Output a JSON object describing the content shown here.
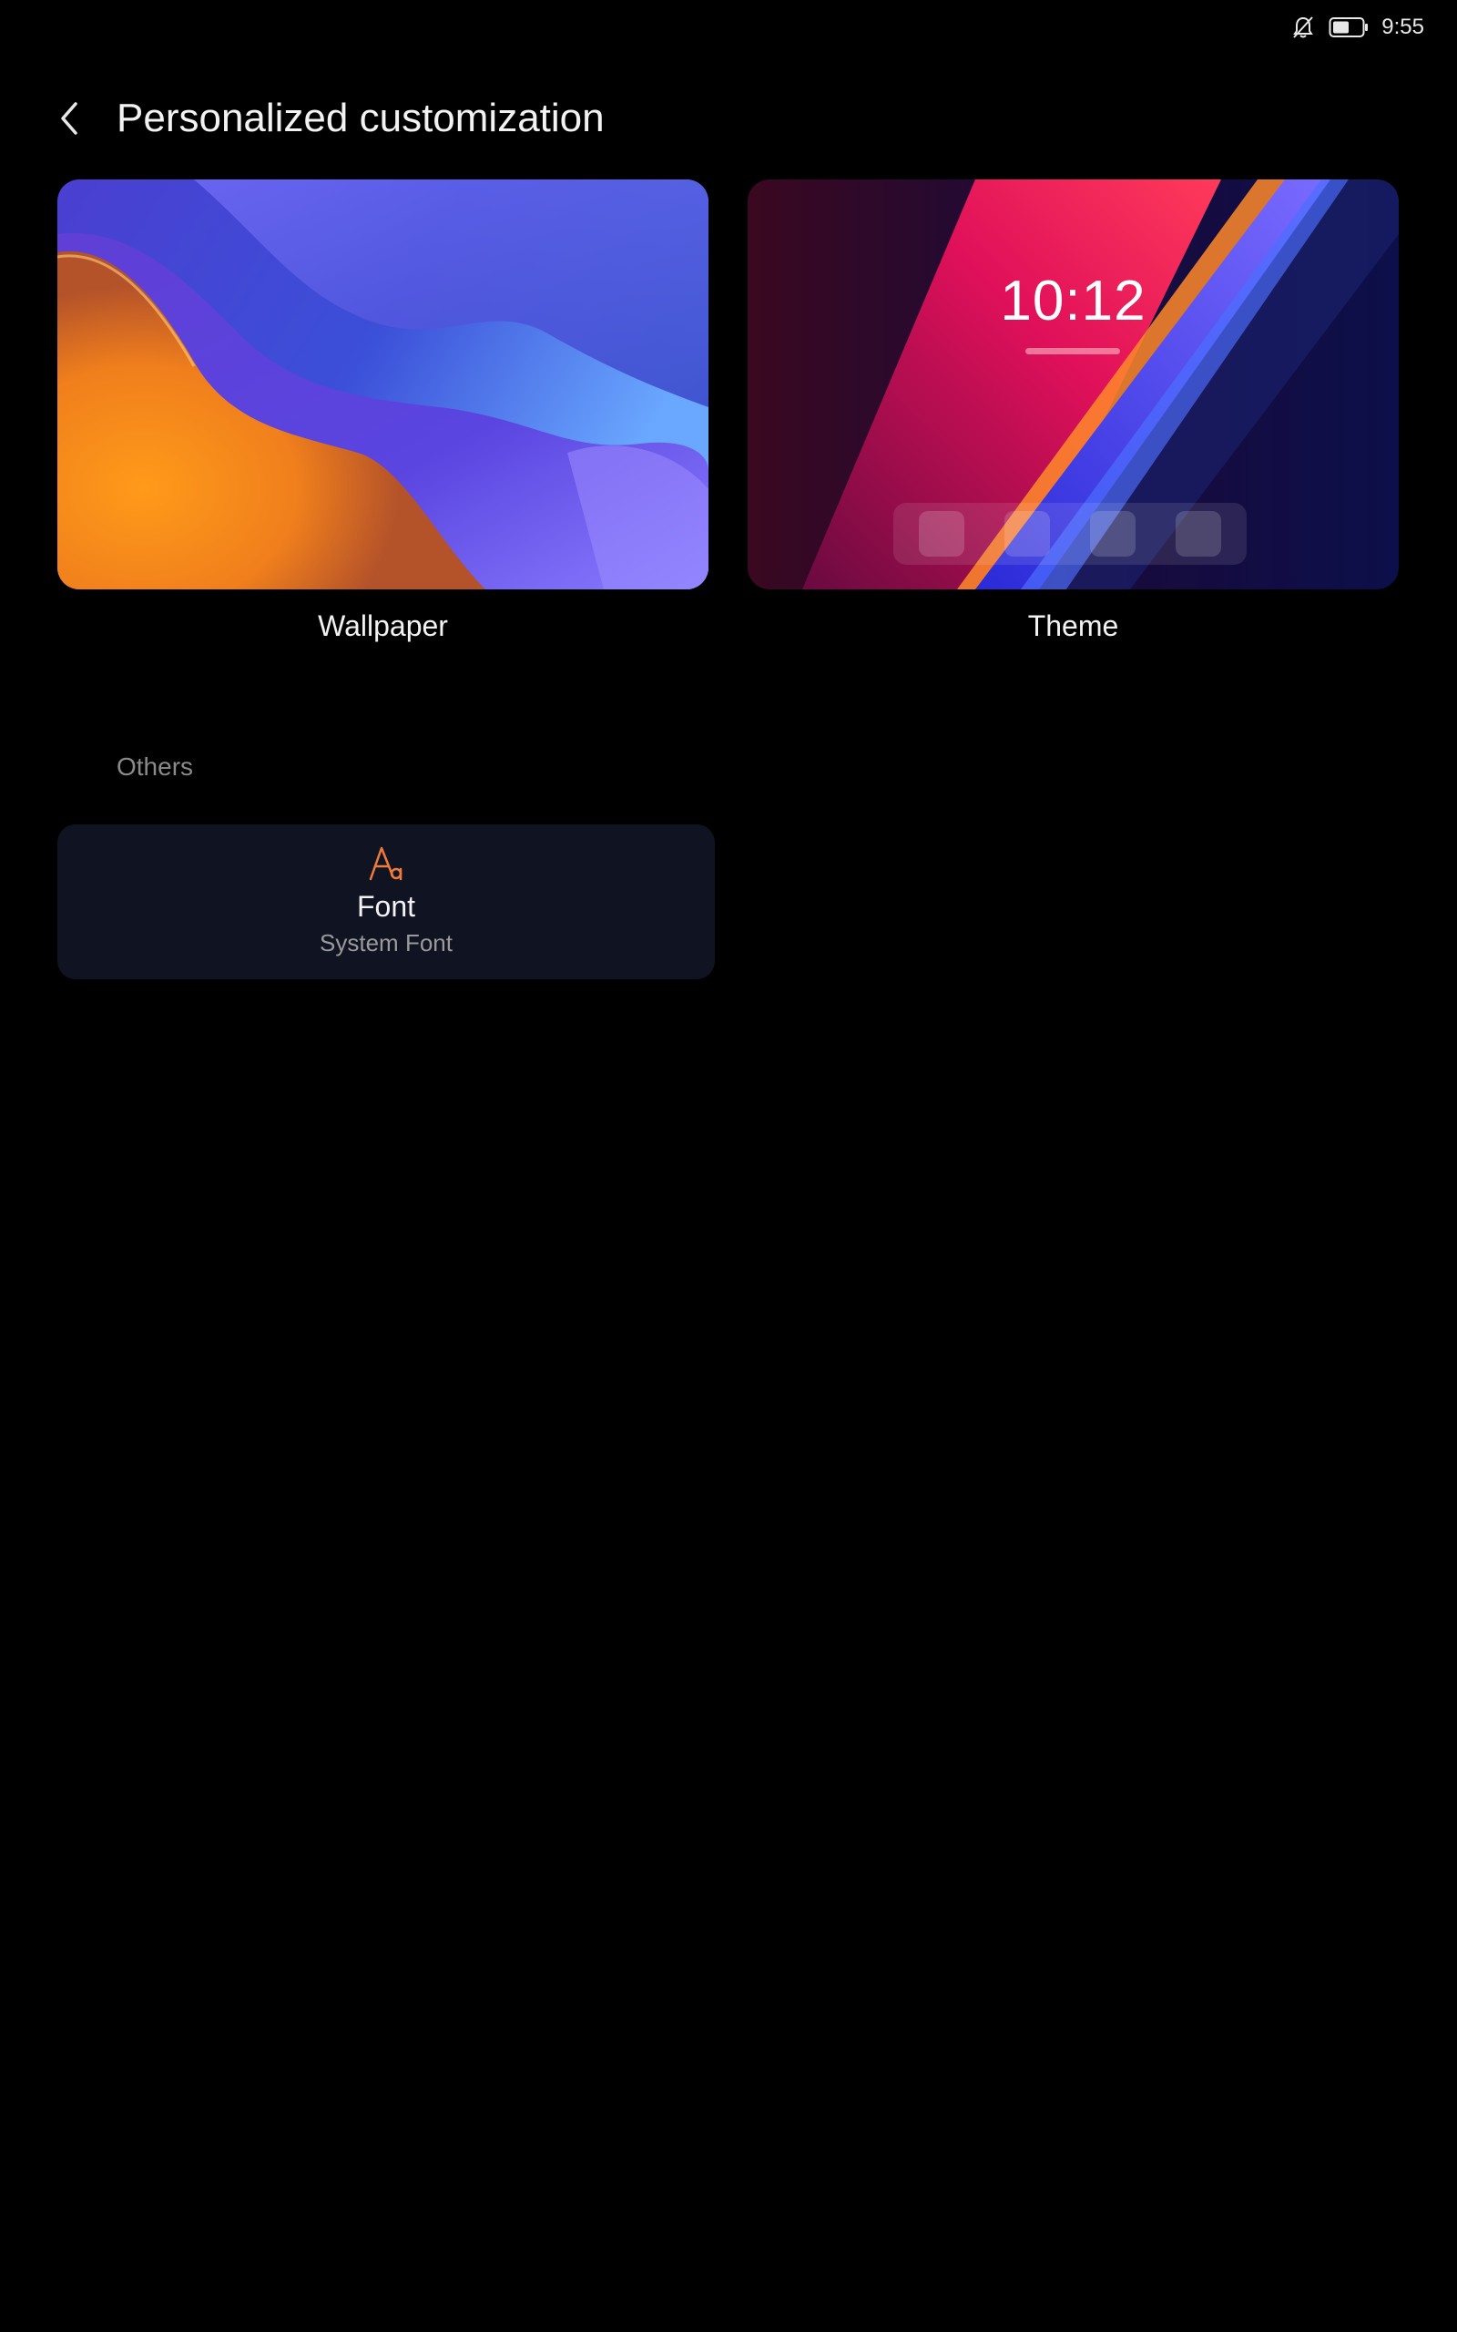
{
  "status_bar": {
    "time": "9:55",
    "icons": [
      "bell-off-icon",
      "battery-icon"
    ]
  },
  "header": {
    "title": "Personalized customization",
    "back_icon": "chevron-left-icon"
  },
  "cards": {
    "wallpaper": {
      "label": "Wallpaper"
    },
    "theme": {
      "label": "Theme",
      "preview_clock": "10:12"
    }
  },
  "others": {
    "section_label": "Others",
    "font": {
      "title": "Font",
      "subtitle": "System Font",
      "icon": "font-icon",
      "icon_color": "#f07a3c"
    }
  },
  "colors": {
    "background": "#000000",
    "tile_background": "#101422",
    "accent": "#f07a3c"
  }
}
